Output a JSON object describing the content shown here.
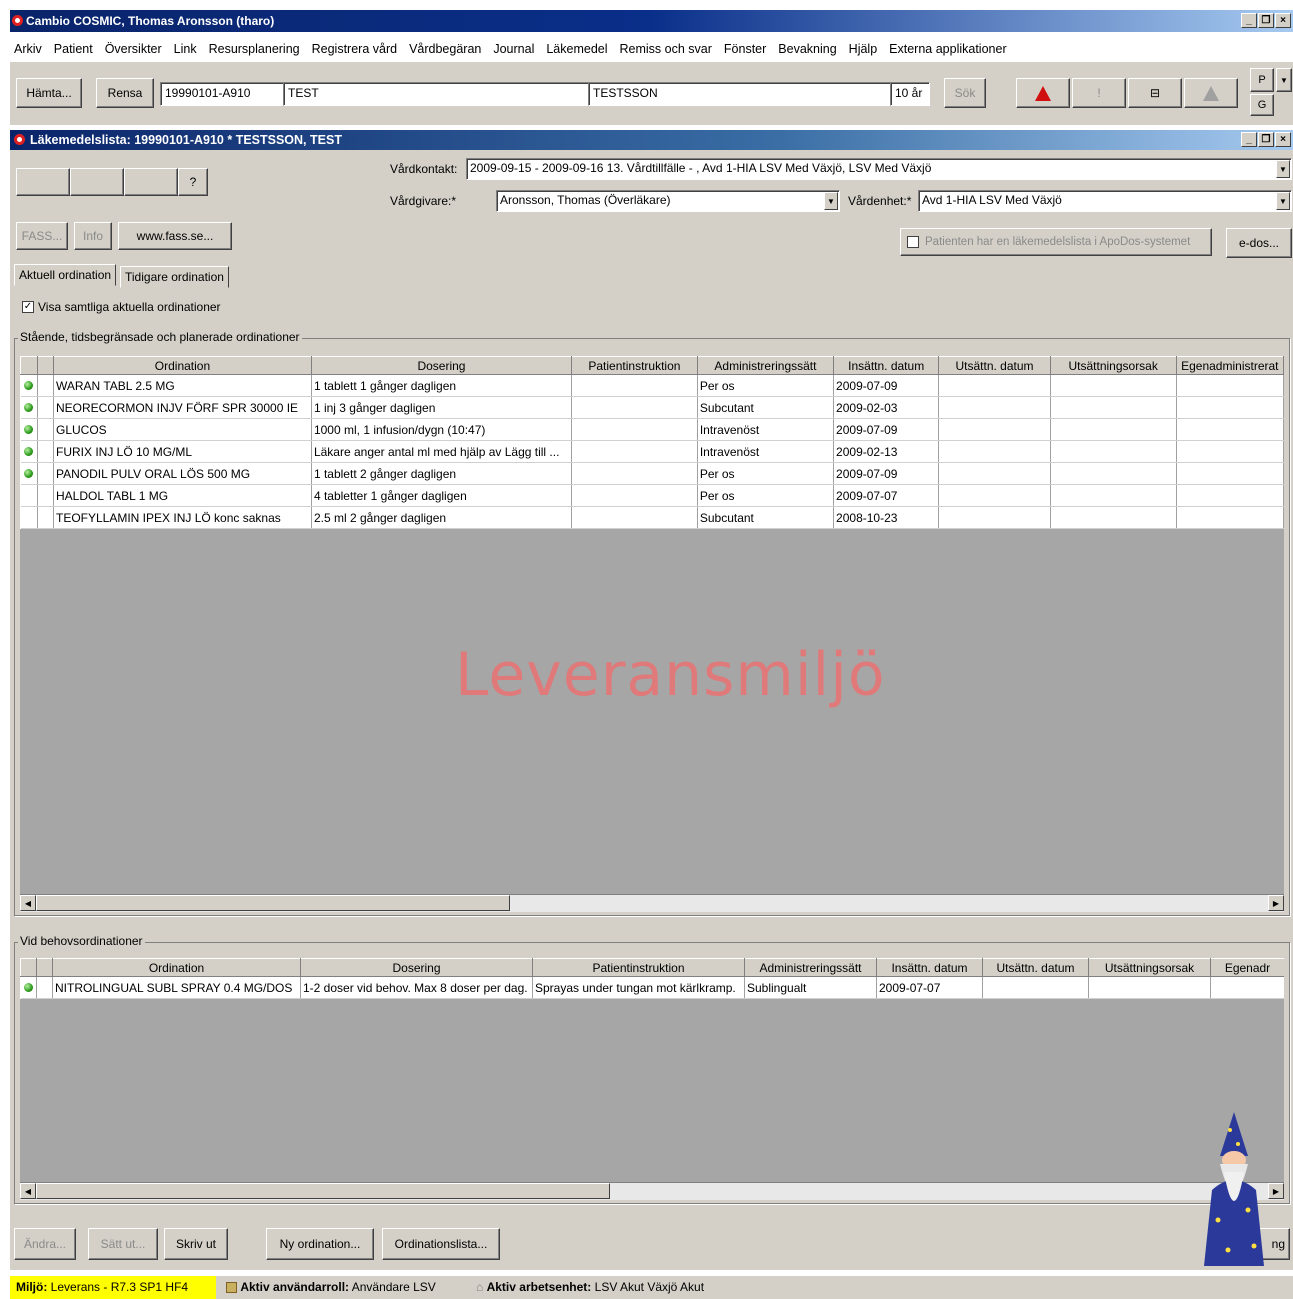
{
  "app": {
    "title": "Cambio COSMIC, Thomas Aronsson (tharo)",
    "menu": [
      "Arkiv",
      "Patient",
      "Översikter",
      "Link",
      "Resursplanering",
      "Registrera vård",
      "Vårdbegäran",
      "Journal",
      "Läkemedel",
      "Remiss och svar",
      "Fönster",
      "Bevakning",
      "Hjälp",
      "Externa applikationer"
    ]
  },
  "patientbar": {
    "hamta_label": "Hämta...",
    "rensa_label": "Rensa",
    "pnr": "19990101-A910",
    "firstname": "TEST",
    "lastname": "TESTSSON",
    "age": "10 år",
    "sok_label": "Sök",
    "p_label": "P",
    "g_label": "G"
  },
  "window": {
    "title": "Läkemedelslista: 19990101-A910 * TESTSSON, TEST",
    "help_label": "?",
    "vardkontakt_label": "Vårdkontakt:",
    "vardkontakt_value": "2009-09-15 - 2009-09-16 13. Vårdtillfälle - , Avd 1-HIA LSV Med Växjö, LSV Med Växjö",
    "vardgivare_label": "Vårdgivare:*",
    "vardgivare_value": "Aronsson, Thomas (Överläkare)",
    "vardenhet_label": "Vårdenhet:*",
    "vardenhet_value": "Avd 1-HIA LSV Med Växjö",
    "fass_label": "FASS...",
    "info_label": "Info",
    "fass_web_label": "www.fass.se...",
    "apodos_label": "Patienten har en läkemedelslista i ApoDos-systemet",
    "edos_label": "e-dos...",
    "tabs": [
      "Aktuell ordination",
      "Tidigare ordination"
    ],
    "visa_label": "Visa samtliga aktuella ordinationer",
    "visa_checked": "✓"
  },
  "standing": {
    "group_label": "Stående, tidsbegränsade och planerade ordinationer",
    "columns": [
      "Ordination",
      "Dosering",
      "Patientinstruktion",
      "Administreringssätt",
      "Insättn. datum",
      "Utsättn. datum",
      "Utsättningsorsak",
      "Egenadministrerat"
    ],
    "rows": [
      {
        "active": true,
        "cells": [
          "WARAN TABL 2.5  MG",
          "1 tablett 1 gånger dagligen",
          "",
          "Per os",
          "2009-07-09",
          "",
          "",
          ""
        ]
      },
      {
        "active": true,
        "cells": [
          "NEORECORMON INJV FÖRF SPR 30000  IE",
          "1 inj 3 gånger dagligen",
          "",
          "Subcutant",
          "2009-02-03",
          "",
          "",
          ""
        ]
      },
      {
        "active": true,
        "cells": [
          "GLUCOS",
          "1000 ml,  1 infusion/dygn (10:47)",
          "",
          "Intravenöst",
          "2009-07-09",
          "",
          "",
          ""
        ]
      },
      {
        "active": true,
        "cells": [
          "FURIX INJ LÖ 10  MG/ML",
          "Läkare anger antal ml med hjälp av Lägg till ...",
          "",
          "Intravenöst",
          "2009-02-13",
          "",
          "",
          ""
        ]
      },
      {
        "active": true,
        "cells": [
          "PANODIL PULV ORAL LÖS 500  MG",
          "1 tablett 2 gånger dagligen",
          "",
          "Per os",
          "2009-07-09",
          "",
          "",
          ""
        ]
      },
      {
        "active": false,
        "cells": [
          "HALDOL TABL 1  MG",
          "4 tabletter 1 gånger dagligen",
          "",
          "Per os",
          "2009-07-07",
          "",
          "",
          ""
        ]
      },
      {
        "active": false,
        "cells": [
          "TEOFYLLAMIN IPEX INJ LÖ konc saknas",
          "2.5 ml 2 gånger dagligen",
          "",
          "Subcutant",
          "2008-10-23",
          "",
          "",
          ""
        ]
      }
    ]
  },
  "watermark": "Leveransmiljö",
  "prn": {
    "group_label": "Vid behovsordinationer",
    "columns": [
      "Ordination",
      "Dosering",
      "Patientinstruktion",
      "Administreringssätt",
      "Insättn. datum",
      "Utsättn. datum",
      "Utsättningsorsak",
      "Egenadr"
    ],
    "rows": [
      {
        "active": true,
        "cells": [
          "NITROLINGUAL SUBL SPRAY 0.4  MG/DOS",
          "1-2 doser vid behov. Max 8 doser per dag.",
          "Sprayas under tungan mot kärlkramp.",
          "Sublingualt",
          "2009-07-07",
          "",
          "",
          ""
        ]
      }
    ]
  },
  "bottom": {
    "andra_label": "Ändra...",
    "satt_ut_label": "Sätt ut...",
    "skriv_ut_label": "Skriv ut",
    "ny_ordination_label": "Ny ordination...",
    "ordinationslista_label": "Ordinationslista...",
    "stang_label": "ng"
  },
  "status": {
    "miljo_label": "Miljö:",
    "miljo_value": "Leverans - R7.3 SP1 HF4",
    "roll_label": "Aktiv användarroll:",
    "roll_value": "Användare LSV",
    "enhet_label": "Aktiv arbetsenhet:",
    "enhet_value": "LSV Akut Växjö Akut"
  },
  "colors": {
    "titlebar": "#0a246a",
    "watermark": "#e07a7a",
    "status_highlight": "#ffff00",
    "active_dot": "#2a9a1a"
  }
}
